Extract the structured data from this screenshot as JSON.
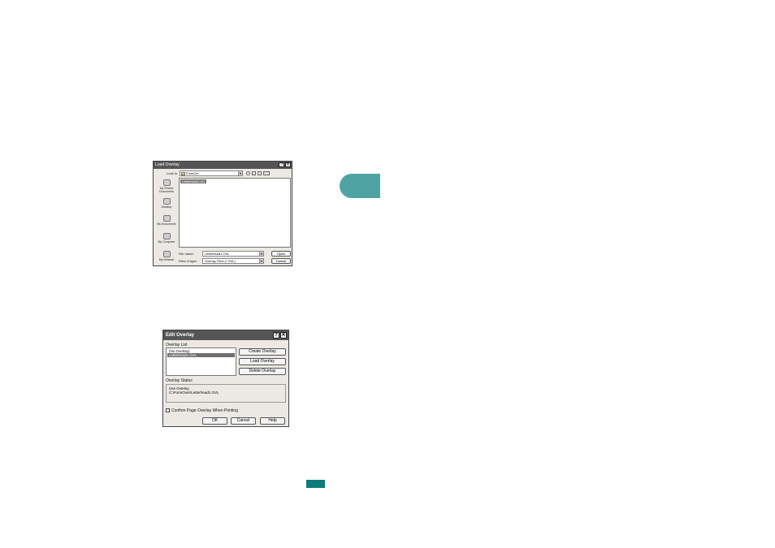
{
  "load_dialog": {
    "title": "Load Overlay",
    "help_glyph": "?",
    "close_glyph": "✕",
    "look_in_label": "Look in:",
    "look_in_value": "FormOvl",
    "toolbar_icons": [
      "back-icon",
      "up-folder-icon",
      "new-folder-icon",
      "view-menu-icon"
    ],
    "places": [
      "My Recent Documents",
      "Desktop",
      "My Documents",
      "My Computer",
      "My Network"
    ],
    "files": [
      "Letterhead1.ovl"
    ],
    "file_name_label": "File name:",
    "file_name_value": "Letterhead1.OVL",
    "file_type_label": "Files of type:",
    "file_type_value": "Overlay Files (*.OVL)",
    "open_button": "Open",
    "cancel_button": "Cancel"
  },
  "edit_dialog": {
    "title": "Edit Overlay",
    "help_glyph": "?",
    "close_glyph": "✕",
    "overlay_list_label": "Overlay List",
    "overlay_list": [
      "(No Overlay)",
      "Letterhead1.OVL"
    ],
    "selected_index": 1,
    "create_button": "Create Overlay",
    "load_button": "Load Overlay",
    "delete_button": "Delete Overlay",
    "status_label": "Overlay Status",
    "status_lines": [
      "Use Overlay",
      "C:\\FormOver\\Letterhead1.OVL"
    ],
    "confirm_label": "Confirm Page Overlay When Printing",
    "confirm_checked": false,
    "ok_button": "OK",
    "cancel_button": "Cancel",
    "help_button": "Help"
  },
  "colors": {
    "chapter_tab": "#4fa3a2",
    "page_marker": "#0c7b79"
  }
}
